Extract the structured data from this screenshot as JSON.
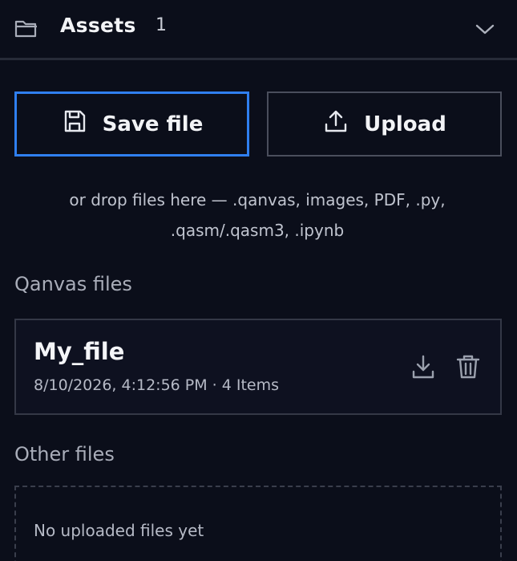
{
  "header": {
    "title": "Assets",
    "count": "1",
    "folder_icon": "folder-icon",
    "collapse_icon": "chevron-down-icon"
  },
  "actions": {
    "save_label": "Save file",
    "upload_label": "Upload",
    "save_icon": "save-icon",
    "upload_icon": "upload-icon"
  },
  "hint": {
    "line1": "or drop files here — .qanvas, images, PDF, .py,",
    "line2": ".qasm/.qasm3, .ipynb"
  },
  "qanvas_section": {
    "label": "Qanvas files",
    "files": [
      {
        "name": "My_file",
        "meta": "8/10/2026, 4:12:56 PM · 4 Items",
        "download_icon": "download-icon",
        "delete_icon": "trash-icon"
      }
    ]
  },
  "other_section": {
    "label": "Other files",
    "empty_text": "No uploaded files yet"
  },
  "colors": {
    "background": "#0b0e1a",
    "accent": "#2f7ff0"
  }
}
